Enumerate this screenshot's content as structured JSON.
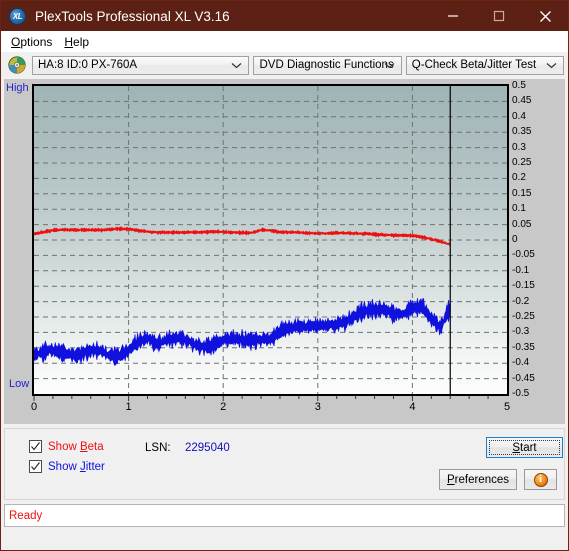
{
  "window": {
    "title": "PlexTools Professional XL V3.16",
    "app_icon": "XL",
    "minimize": "minimize-icon",
    "maximize": "maximize-icon",
    "close": "close-icon"
  },
  "menubar": {
    "items": [
      {
        "label": "Options",
        "accel": "O"
      },
      {
        "label": "Help",
        "accel": "H"
      }
    ]
  },
  "toolbar": {
    "drive_icon": "optical-disc-icon",
    "drive": "HA:8 ID:0  PX-760A",
    "function": "DVD Diagnostic Functions",
    "test": "Q-Check Beta/Jitter Test"
  },
  "graph": {
    "label_high": "High",
    "label_low": "Low"
  },
  "controls": {
    "show_beta": {
      "label_pre": "Show ",
      "accel": "B",
      "label_post": "eta",
      "checked": true
    },
    "show_jitter": {
      "label_pre": "Show ",
      "accel": "J",
      "label_post": "itter",
      "checked": true
    },
    "lsn_label": "LSN:",
    "lsn_value": "2295040",
    "start": {
      "pre": "",
      "accel": "S",
      "post": "tart"
    },
    "preferences": {
      "pre": "",
      "accel": "P",
      "post": "references"
    },
    "info_icon": "info-icon",
    "info_glyph": "i"
  },
  "statusbar": {
    "text": "Ready"
  },
  "colors": {
    "titlebar": "#5d2014",
    "beta": "#ee1111",
    "jitter": "#1111dd",
    "accent": "#1a7fd4"
  },
  "chart_data": {
    "type": "line",
    "title": "Q-Check Beta/Jitter Test",
    "xlabel": "",
    "ylabel": "",
    "xlim": [
      0,
      5
    ],
    "ylim": [
      -0.5,
      0.5
    ],
    "grid": true,
    "legend_position": "below-left",
    "x_ticks": [
      0,
      1,
      2,
      3,
      4,
      5
    ],
    "y_ticks": [
      0.5,
      0.45,
      0.4,
      0.35,
      0.3,
      0.25,
      0.2,
      0.15,
      0.1,
      0.05,
      0,
      -0.05,
      -0.1,
      -0.15,
      -0.2,
      -0.25,
      -0.3,
      -0.35,
      -0.4,
      -0.45,
      -0.5
    ],
    "y_tick_labels": [
      "0.5",
      "0.45",
      "0.4",
      "0.35",
      "0.3",
      "0.25",
      "0.2",
      "0.15",
      "0.1",
      "0.05",
      "0",
      "-0.05",
      "-0.1",
      "-0.15",
      "-0.2",
      "-0.25",
      "-0.3",
      "-0.35",
      "-0.4",
      "-0.45",
      "-0.5"
    ],
    "x_tick_labels": [
      "0",
      "1",
      "2",
      "3",
      "4",
      "5"
    ],
    "cursor_x": 4.4,
    "data_end_x": 4.4,
    "series": [
      {
        "name": "Beta",
        "color": "#ee1111",
        "x": [
          0.0,
          0.1,
          0.2,
          0.3,
          0.4,
          0.5,
          0.6,
          0.7,
          0.8,
          0.9,
          1.0,
          1.1,
          1.2,
          1.3,
          1.4,
          1.5,
          1.6,
          1.7,
          1.8,
          1.9,
          2.0,
          2.1,
          2.2,
          2.3,
          2.4,
          2.5,
          2.6,
          2.7,
          2.8,
          2.9,
          3.0,
          3.1,
          3.2,
          3.3,
          3.4,
          3.5,
          3.6,
          3.7,
          3.8,
          3.9,
          4.0,
          4.1,
          4.2,
          4.3,
          4.4
        ],
        "values": [
          0.02,
          0.024,
          0.03,
          0.032,
          0.033,
          0.034,
          0.034,
          0.033,
          0.034,
          0.035,
          0.034,
          0.03,
          0.028,
          0.026,
          0.026,
          0.025,
          0.024,
          0.024,
          0.024,
          0.026,
          0.027,
          0.026,
          0.025,
          0.024,
          0.032,
          0.03,
          0.024,
          0.025,
          0.025,
          0.024,
          0.023,
          0.022,
          0.022,
          0.021,
          0.02,
          0.02,
          0.019,
          0.018,
          0.017,
          0.015,
          0.013,
          0.008,
          0.002,
          -0.006,
          -0.014
        ],
        "noise": 0.006
      },
      {
        "name": "Jitter",
        "color": "#1111dd",
        "x": [
          0.0,
          0.1,
          0.2,
          0.3,
          0.4,
          0.5,
          0.6,
          0.7,
          0.8,
          0.9,
          1.0,
          1.1,
          1.2,
          1.3,
          1.4,
          1.5,
          1.6,
          1.7,
          1.8,
          1.9,
          2.0,
          2.1,
          2.2,
          2.3,
          2.4,
          2.5,
          2.6,
          2.7,
          2.8,
          2.9,
          3.0,
          3.1,
          3.2,
          3.3,
          3.4,
          3.5,
          3.6,
          3.7,
          3.8,
          3.9,
          4.0,
          4.1,
          4.2,
          4.3,
          4.4
        ],
        "values": [
          -0.375,
          -0.372,
          -0.36,
          -0.362,
          -0.368,
          -0.37,
          -0.365,
          -0.362,
          -0.368,
          -0.372,
          -0.36,
          -0.34,
          -0.318,
          -0.33,
          -0.32,
          -0.322,
          -0.33,
          -0.338,
          -0.34,
          -0.336,
          -0.33,
          -0.326,
          -0.32,
          -0.318,
          -0.322,
          -0.33,
          -0.3,
          -0.282,
          -0.272,
          -0.28,
          -0.288,
          -0.28,
          -0.27,
          -0.258,
          -0.248,
          -0.238,
          -0.228,
          -0.22,
          -0.232,
          -0.244,
          -0.228,
          -0.218,
          -0.248,
          -0.28,
          -0.222
        ],
        "noise": 0.028
      }
    ]
  }
}
